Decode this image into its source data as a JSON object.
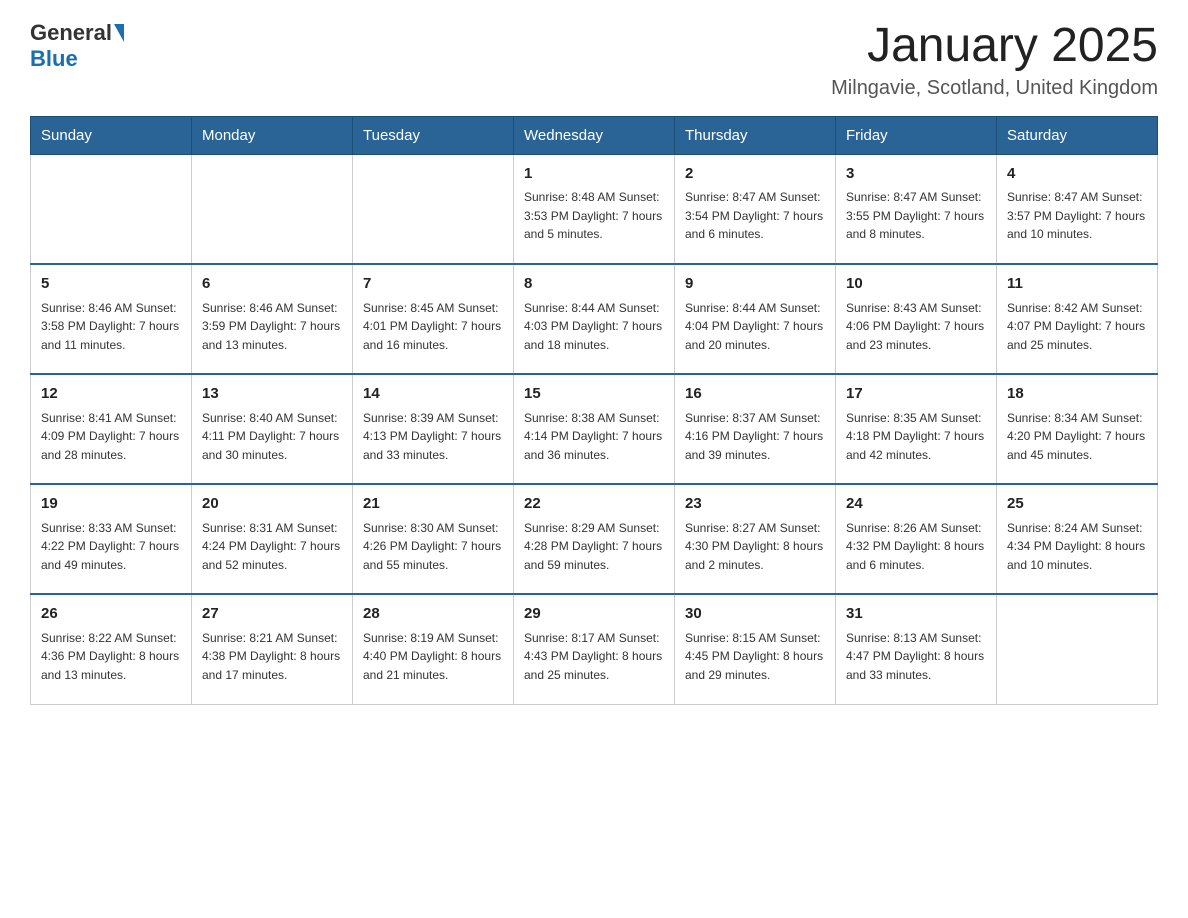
{
  "logo": {
    "general": "General",
    "blue": "Blue"
  },
  "header": {
    "title": "January 2025",
    "subtitle": "Milngavie, Scotland, United Kingdom"
  },
  "weekdays": [
    "Sunday",
    "Monday",
    "Tuesday",
    "Wednesday",
    "Thursday",
    "Friday",
    "Saturday"
  ],
  "weeks": [
    [
      {
        "day": "",
        "info": ""
      },
      {
        "day": "",
        "info": ""
      },
      {
        "day": "",
        "info": ""
      },
      {
        "day": "1",
        "info": "Sunrise: 8:48 AM\nSunset: 3:53 PM\nDaylight: 7 hours\nand 5 minutes."
      },
      {
        "day": "2",
        "info": "Sunrise: 8:47 AM\nSunset: 3:54 PM\nDaylight: 7 hours\nand 6 minutes."
      },
      {
        "day": "3",
        "info": "Sunrise: 8:47 AM\nSunset: 3:55 PM\nDaylight: 7 hours\nand 8 minutes."
      },
      {
        "day": "4",
        "info": "Sunrise: 8:47 AM\nSunset: 3:57 PM\nDaylight: 7 hours\nand 10 minutes."
      }
    ],
    [
      {
        "day": "5",
        "info": "Sunrise: 8:46 AM\nSunset: 3:58 PM\nDaylight: 7 hours\nand 11 minutes."
      },
      {
        "day": "6",
        "info": "Sunrise: 8:46 AM\nSunset: 3:59 PM\nDaylight: 7 hours\nand 13 minutes."
      },
      {
        "day": "7",
        "info": "Sunrise: 8:45 AM\nSunset: 4:01 PM\nDaylight: 7 hours\nand 16 minutes."
      },
      {
        "day": "8",
        "info": "Sunrise: 8:44 AM\nSunset: 4:03 PM\nDaylight: 7 hours\nand 18 minutes."
      },
      {
        "day": "9",
        "info": "Sunrise: 8:44 AM\nSunset: 4:04 PM\nDaylight: 7 hours\nand 20 minutes."
      },
      {
        "day": "10",
        "info": "Sunrise: 8:43 AM\nSunset: 4:06 PM\nDaylight: 7 hours\nand 23 minutes."
      },
      {
        "day": "11",
        "info": "Sunrise: 8:42 AM\nSunset: 4:07 PM\nDaylight: 7 hours\nand 25 minutes."
      }
    ],
    [
      {
        "day": "12",
        "info": "Sunrise: 8:41 AM\nSunset: 4:09 PM\nDaylight: 7 hours\nand 28 minutes."
      },
      {
        "day": "13",
        "info": "Sunrise: 8:40 AM\nSunset: 4:11 PM\nDaylight: 7 hours\nand 30 minutes."
      },
      {
        "day": "14",
        "info": "Sunrise: 8:39 AM\nSunset: 4:13 PM\nDaylight: 7 hours\nand 33 minutes."
      },
      {
        "day": "15",
        "info": "Sunrise: 8:38 AM\nSunset: 4:14 PM\nDaylight: 7 hours\nand 36 minutes."
      },
      {
        "day": "16",
        "info": "Sunrise: 8:37 AM\nSunset: 4:16 PM\nDaylight: 7 hours\nand 39 minutes."
      },
      {
        "day": "17",
        "info": "Sunrise: 8:35 AM\nSunset: 4:18 PM\nDaylight: 7 hours\nand 42 minutes."
      },
      {
        "day": "18",
        "info": "Sunrise: 8:34 AM\nSunset: 4:20 PM\nDaylight: 7 hours\nand 45 minutes."
      }
    ],
    [
      {
        "day": "19",
        "info": "Sunrise: 8:33 AM\nSunset: 4:22 PM\nDaylight: 7 hours\nand 49 minutes."
      },
      {
        "day": "20",
        "info": "Sunrise: 8:31 AM\nSunset: 4:24 PM\nDaylight: 7 hours\nand 52 minutes."
      },
      {
        "day": "21",
        "info": "Sunrise: 8:30 AM\nSunset: 4:26 PM\nDaylight: 7 hours\nand 55 minutes."
      },
      {
        "day": "22",
        "info": "Sunrise: 8:29 AM\nSunset: 4:28 PM\nDaylight: 7 hours\nand 59 minutes."
      },
      {
        "day": "23",
        "info": "Sunrise: 8:27 AM\nSunset: 4:30 PM\nDaylight: 8 hours\nand 2 minutes."
      },
      {
        "day": "24",
        "info": "Sunrise: 8:26 AM\nSunset: 4:32 PM\nDaylight: 8 hours\nand 6 minutes."
      },
      {
        "day": "25",
        "info": "Sunrise: 8:24 AM\nSunset: 4:34 PM\nDaylight: 8 hours\nand 10 minutes."
      }
    ],
    [
      {
        "day": "26",
        "info": "Sunrise: 8:22 AM\nSunset: 4:36 PM\nDaylight: 8 hours\nand 13 minutes."
      },
      {
        "day": "27",
        "info": "Sunrise: 8:21 AM\nSunset: 4:38 PM\nDaylight: 8 hours\nand 17 minutes."
      },
      {
        "day": "28",
        "info": "Sunrise: 8:19 AM\nSunset: 4:40 PM\nDaylight: 8 hours\nand 21 minutes."
      },
      {
        "day": "29",
        "info": "Sunrise: 8:17 AM\nSunset: 4:43 PM\nDaylight: 8 hours\nand 25 minutes."
      },
      {
        "day": "30",
        "info": "Sunrise: 8:15 AM\nSunset: 4:45 PM\nDaylight: 8 hours\nand 29 minutes."
      },
      {
        "day": "31",
        "info": "Sunrise: 8:13 AM\nSunset: 4:47 PM\nDaylight: 8 hours\nand 33 minutes."
      },
      {
        "day": "",
        "info": ""
      }
    ]
  ]
}
